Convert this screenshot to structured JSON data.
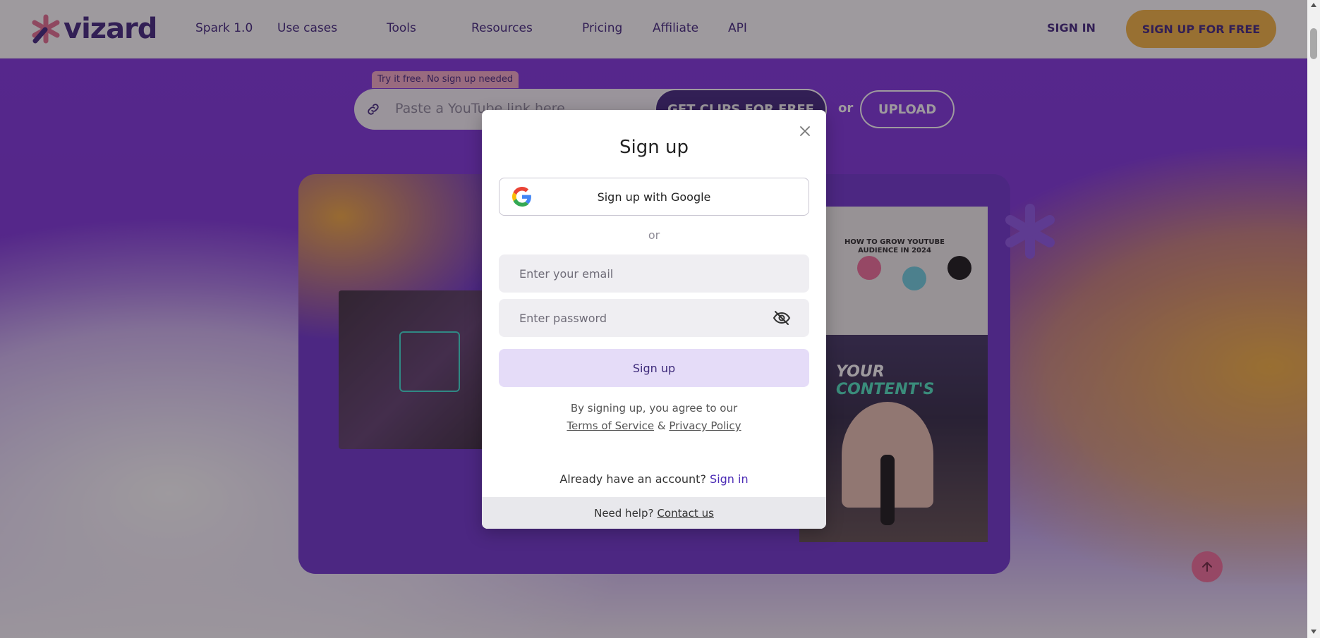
{
  "nav": {
    "logo": "vizard",
    "items": [
      "Spark 1.0",
      "Use cases",
      "Tools",
      "Resources",
      "Pricing",
      "Affiliate",
      "API"
    ],
    "sign_in": "SIGN IN",
    "sign_up_free": "SIGN UP FOR FREE"
  },
  "hero": {
    "badge": "Try it free. No sign up needed",
    "input_placeholder": "Paste a YouTube link here",
    "get_clips": "GET CLIPS FOR FREE",
    "or": "or",
    "upload": "UPLOAD",
    "video_title": "HOW TO GROW YOUTUBE AUDIENCE IN 2024",
    "caption_word1": "YOUR",
    "caption_word2": "CONTENT'S"
  },
  "modal": {
    "title": "Sign up",
    "google_button": "Sign up with Google",
    "or": "or",
    "email_placeholder": "Enter your email",
    "password_placeholder": "Enter password",
    "submit": "Sign up",
    "terms_prefix": "By signing up, you agree to our",
    "terms_link": "Terms of Service",
    "terms_and": "&",
    "privacy_link": "Privacy Policy",
    "already_text": "Already have an account?",
    "sign_in_link": "Sign in",
    "help_text": "Need help?",
    "contact_link": "Contact us"
  },
  "colors": {
    "brand_purple": "#3b1f7a",
    "accent_yellow": "#f5b33b",
    "badge_pink": "#f6a9c6",
    "submit_bg": "#e5dcf8"
  }
}
